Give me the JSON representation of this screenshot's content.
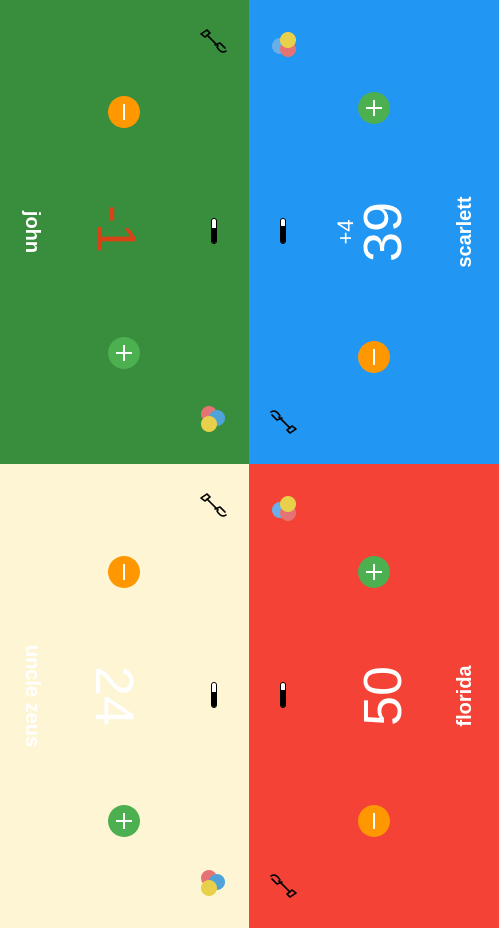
{
  "players": [
    {
      "id": "tl",
      "name": "john",
      "score": "-1",
      "delta": ""
    },
    {
      "id": "tr",
      "name": "scarlett",
      "score": "39",
      "delta": "+4"
    },
    {
      "id": "bl",
      "name": "uncle zeus",
      "score": "24",
      "delta": ""
    },
    {
      "id": "br",
      "name": "florida",
      "score": "50",
      "delta": ""
    }
  ],
  "icons": {
    "increment": "plus-icon",
    "decrement": "minus-icon",
    "tools": "hammer-icon",
    "color_picker": "palette-icon",
    "health": "battery-icon"
  },
  "colors": {
    "john_bg": "#388e3c",
    "scarlett_bg": "#2196f3",
    "uncle_zeus_bg": "#fdf5d4",
    "florida_bg": "#f44336",
    "plus": "#4caf50",
    "minus": "#ff9800",
    "negative_score": "#d84315"
  }
}
